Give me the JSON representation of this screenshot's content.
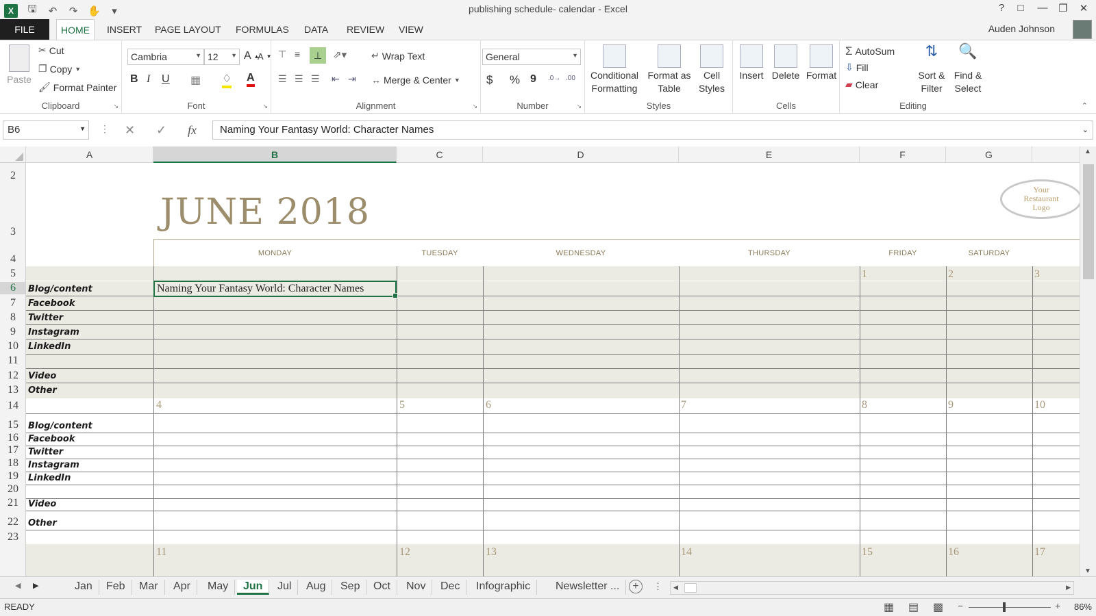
{
  "title_bar": {
    "app_title": "publishing schedule- calendar - Excel",
    "help_label": "?"
  },
  "ribbon_tabs": {
    "file": "FILE",
    "tabs": [
      "HOME",
      "INSERT",
      "PAGE LAYOUT",
      "FORMULAS",
      "DATA",
      "REVIEW",
      "VIEW"
    ],
    "active": "HOME",
    "user_name": "Auden Johnson"
  },
  "ribbon": {
    "clipboard": {
      "paste": "Paste",
      "cut": "Cut",
      "copy": "Copy",
      "format_painter": "Format Painter",
      "label": "Clipboard"
    },
    "font": {
      "name": "Cambria",
      "size": "12",
      "bold": "B",
      "italic": "I",
      "underline": "U",
      "label": "Font"
    },
    "alignment": {
      "wrap_text": "Wrap Text",
      "merge_center": "Merge & Center",
      "label": "Alignment"
    },
    "number": {
      "format": "General",
      "currency": "$",
      "percent": "%",
      "comma": "9",
      "label": "Number"
    },
    "styles": {
      "conditional": "Conditional",
      "conditional2": "Formatting",
      "format_table": "Format as",
      "format_table2": "Table",
      "cell_styles": "Cell",
      "cell_styles2": "Styles",
      "label": "Styles"
    },
    "cells": {
      "insert": "Insert",
      "delete": "Delete",
      "format": "Format",
      "label": "Cells"
    },
    "editing": {
      "autosum": "AutoSum",
      "fill": "Fill",
      "clear": "Clear",
      "sort": "Sort &",
      "sort2": "Filter",
      "find": "Find &",
      "find2": "Select",
      "label": "Editing"
    }
  },
  "formula_bar": {
    "name_box": "B6",
    "formula": "Naming Your Fantasy World: Character Names",
    "fx": "fx"
  },
  "columns": [
    "A",
    "B",
    "C",
    "D",
    "E",
    "F",
    "G"
  ],
  "selected_column": "B",
  "rows": [
    "2",
    "3",
    "4",
    "5",
    "6",
    "7",
    "8",
    "9",
    "10",
    "11",
    "12",
    "13",
    "14",
    "15",
    "16",
    "17",
    "18",
    "19",
    "20",
    "21",
    "22",
    "23"
  ],
  "selected_row": "6",
  "sheet": {
    "month_title": "JUNE 2018",
    "logo_text": [
      "Your",
      "Restaurant",
      "Logo"
    ],
    "day_names": [
      "MONDAY",
      "TUESDAY",
      "WEDNESDAY",
      "THURSDAY",
      "FRIDAY",
      "SATURDAY"
    ],
    "week1_numbers": [
      "1",
      "2",
      "3"
    ],
    "week2_numbers": [
      "4",
      "5",
      "6",
      "7",
      "8",
      "9",
      "10"
    ],
    "week3_numbers": [
      "11",
      "12",
      "13",
      "14",
      "15",
      "16",
      "17"
    ],
    "week1_labels": [
      "Blog/content",
      "Facebook",
      "Twitter",
      "Instagram",
      "LinkedIn",
      "",
      "Video",
      "Other"
    ],
    "week2_labels": [
      "Blog/content",
      "Facebook",
      "Twitter",
      "Instagram",
      "LinkedIn",
      "",
      "Video",
      "Other"
    ],
    "active_cell_value": "Naming Your Fantasy World: Character Names"
  },
  "sheet_tabs": {
    "tabs": [
      "Jan",
      "Feb",
      "Mar",
      "Apr",
      "May",
      "Jun",
      "Jul",
      "Aug",
      "Sep",
      "Oct",
      "Nov",
      "Dec",
      "Infographic",
      "Newsletter ..."
    ],
    "active": "Jun"
  },
  "status_bar": {
    "status": "READY",
    "zoom": "86%"
  },
  "colors": {
    "accent": "#1f7244",
    "band": "#ecebe3",
    "title": "#9c8d6c"
  }
}
